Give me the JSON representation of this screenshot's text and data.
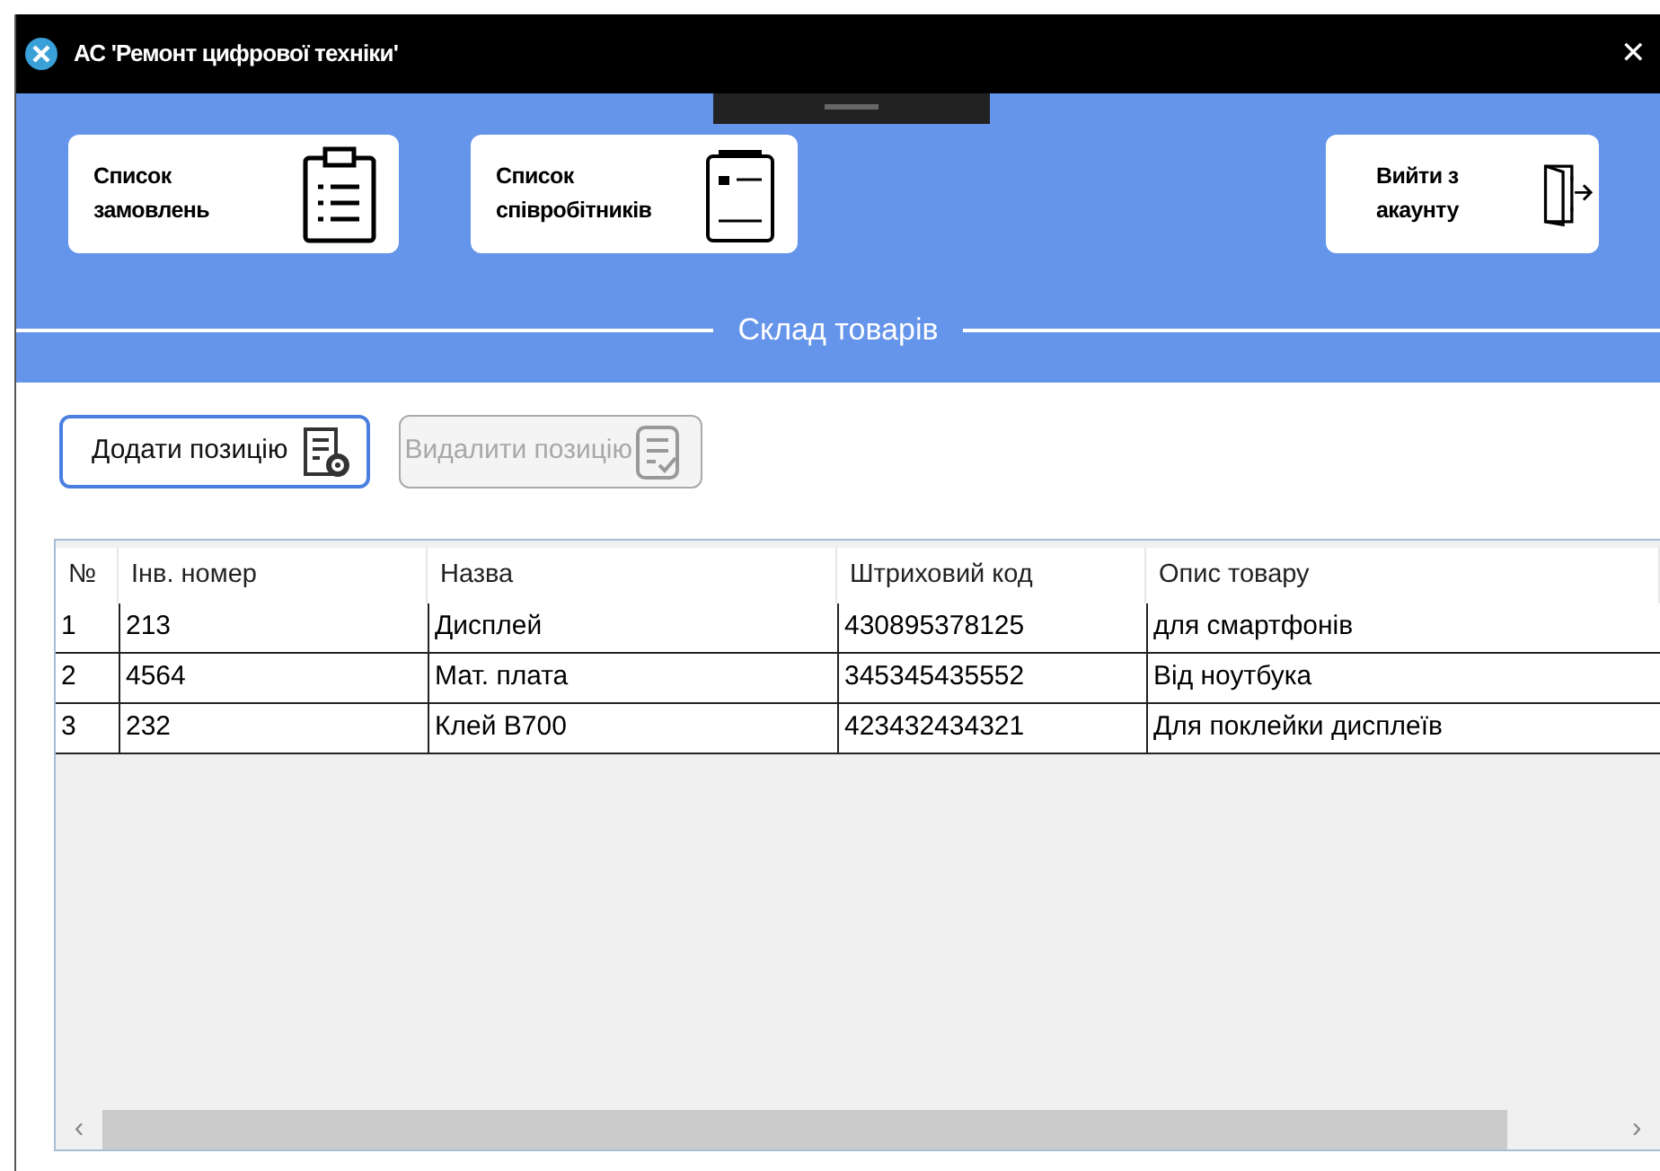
{
  "window": {
    "title": "АС 'Ремонт цифрової техніки'",
    "close": "✕"
  },
  "nav_buttons": [
    {
      "label": "Список замовлень",
      "kind": "clipboard"
    },
    {
      "label": "Список співробітників",
      "kind": "card"
    },
    {
      "label": "Вийти з акаунту",
      "kind": "door"
    }
  ],
  "section_title": "Склад товарів",
  "actions": [
    {
      "label": "Додати позицію",
      "kind": "gear",
      "disabled": false,
      "focused": true
    },
    {
      "label": "Видалити позицію",
      "kind": "check",
      "disabled": true,
      "focused": false
    }
  ],
  "table": {
    "columns": [
      "№",
      "Інв. номер",
      "Назва",
      "Штриховий код",
      "Опис товару"
    ],
    "rows": [
      [
        "1",
        "213",
        "Дисплей",
        "430895378125",
        "для смартфонів"
      ],
      [
        "2",
        "4564",
        "Мат. плата",
        "345345435552",
        "Від ноутбука"
      ],
      [
        "3",
        "232",
        "Клей B700",
        "423432434321",
        "Для поклейки дисплеїв"
      ]
    ],
    "scroll_left": "‹",
    "scroll_right": "›"
  }
}
